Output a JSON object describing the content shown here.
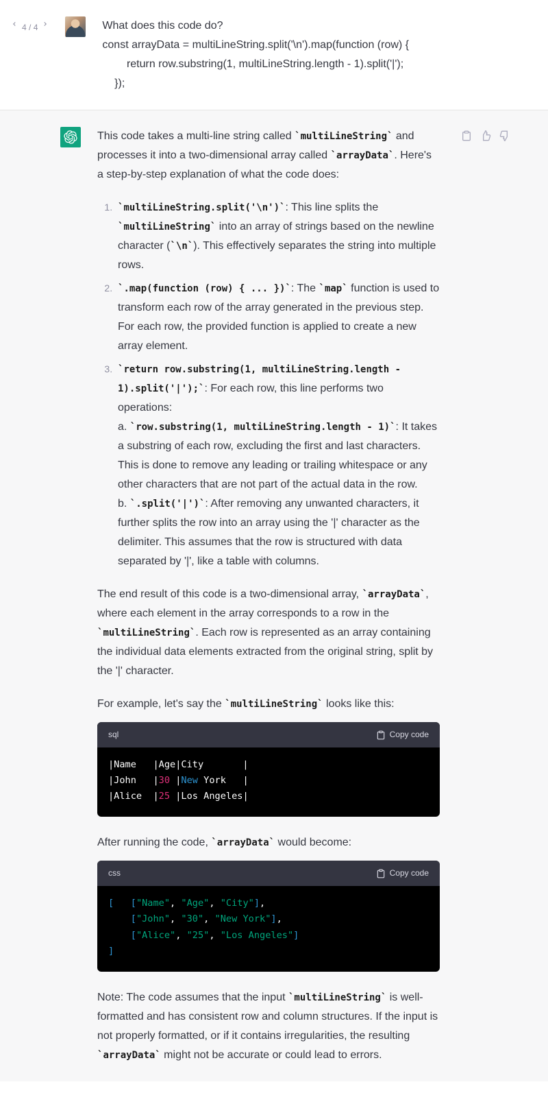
{
  "pager": {
    "current": "4",
    "total": "4",
    "sep": " / "
  },
  "user": {
    "l1": "What does this code do?",
    "l2": "const arrayData = multiLineString.split('\\n').map(function (row) {",
    "l3": "        return row.substring(1, multiLineString.length - 1).split('|');",
    "l4": "    });"
  },
  "assistant": {
    "intro_a": "This code takes a multi-line string called ",
    "intro_code1": "multiLineString",
    "intro_b": " and processes it into a two-dimensional array called ",
    "intro_code2": "arrayData",
    "intro_c": ". Here's a step-by-step explanation of what the code does:",
    "li1_code": "multiLineString.split('\\n')",
    "li1_a": ": This line splits the ",
    "li1_code2": "multiLineString",
    "li1_b": " into an array of strings based on the newline character (",
    "li1_code3": "\\n",
    "li1_c": "). This effectively separates the string into multiple rows.",
    "li2_code": ".map(function (row) { ... })",
    "li2_a": ": The ",
    "li2_code2": "map",
    "li2_b": " function is used to transform each row of the array generated in the previous step. For each row, the provided function is applied to create a new array element.",
    "li3_code": "return row.substring(1, multiLineString.length - 1).split('|');",
    "li3_a": ": For each row, this line performs two operations:",
    "li3_sa": "a. ",
    "li3_code2": "row.substring(1, multiLineString.length - 1)",
    "li3_b": ": It takes a substring of each row, excluding the first and last characters. This is done to remove any leading or trailing whitespace or any other characters that are not part of the actual data in the row.",
    "li3_sb": "b. ",
    "li3_code3": ".split('|')",
    "li3_c": ": After removing any unwanted characters, it further splits the row into an array using the '|' character as the delimiter. This assumes that the row is structured with data separated by '|', like a table with columns.",
    "result_a": "The end result of this code is a two-dimensional array, ",
    "result_code1": "arrayData",
    "result_b": ", where each element in the array corresponds to a row in the ",
    "result_code2": "multiLineString",
    "result_c": ". Each row is represented as an array containing the individual data elements extracted from the original string, split by the '|' character.",
    "example_a": "For example, let's say the ",
    "example_code": "multiLineString",
    "example_b": " looks like this:",
    "after_a": "After running the code, ",
    "after_code": "arrayData",
    "after_b": " would become:",
    "note_a": "Note: The code assumes that the input ",
    "note_code1": "multiLineString",
    "note_b": " is well-formatted and has consistent row and column structures. If the input is not properly formatted, or if it contains irregularities, the resulting ",
    "note_code2": "arrayData",
    "note_c": " might not be accurate or could lead to errors."
  },
  "codeblock1": {
    "lang": "sql",
    "copy": "Copy code"
  },
  "codeblock2": {
    "lang": "css",
    "copy": "Copy code"
  },
  "chart_data": {
    "type": "table",
    "input_rows": [
      [
        "Name",
        "Age",
        "City"
      ],
      [
        "John",
        "30",
        "New York"
      ],
      [
        "Alice",
        "25",
        "Los Angeles"
      ]
    ],
    "output_array": [
      [
        "Name",
        "Age",
        "City"
      ],
      [
        "John",
        "30",
        "New York"
      ],
      [
        "Alice",
        "25",
        "Los Angeles"
      ]
    ]
  }
}
